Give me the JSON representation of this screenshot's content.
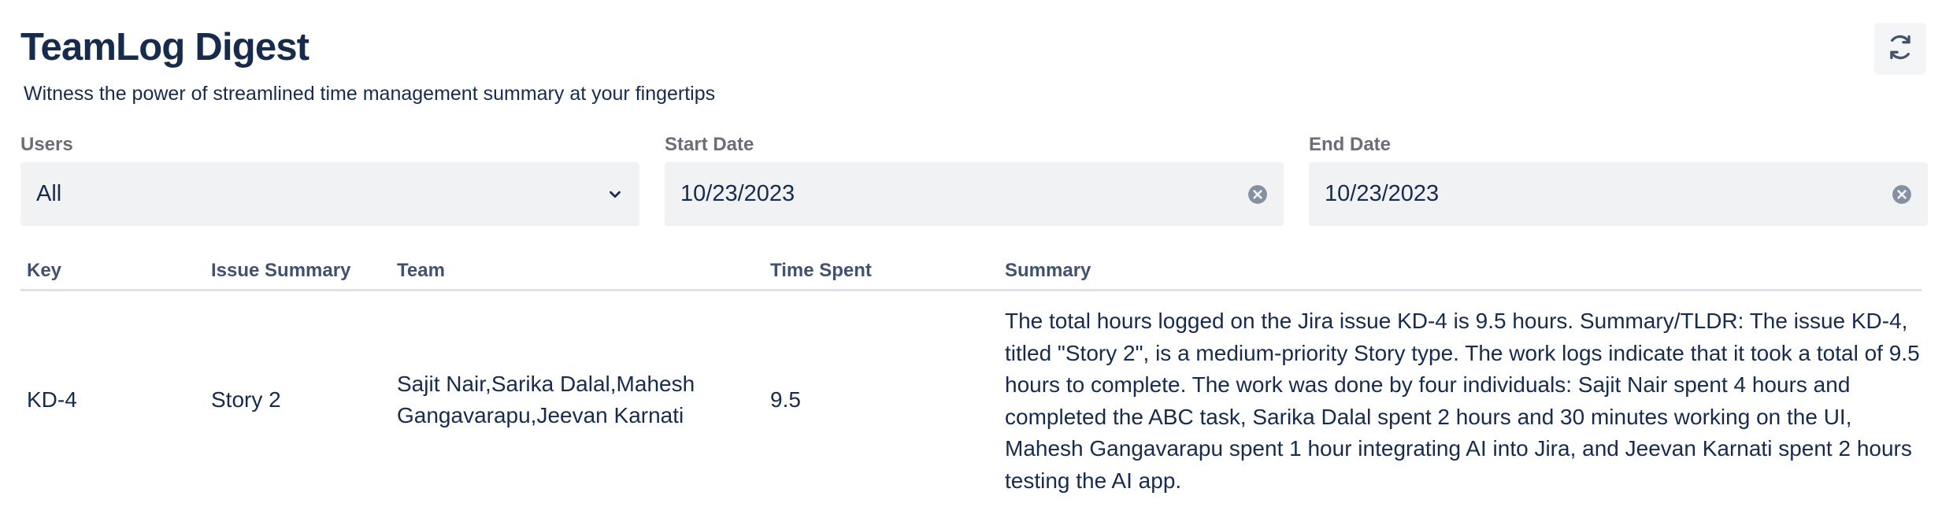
{
  "header": {
    "title": "TeamLog Digest",
    "subtitle": "Witness the power of streamlined time management summary at your fingertips",
    "refresh_icon": "refresh-icon"
  },
  "filters": {
    "users": {
      "label": "Users",
      "value": "All"
    },
    "start_date": {
      "label": "Start Date",
      "value": "10/23/2023"
    },
    "end_date": {
      "label": "End Date",
      "value": "10/23/2023"
    }
  },
  "table": {
    "columns": [
      "Key",
      "Issue Summary",
      "Team",
      "Time Spent",
      "Summary"
    ],
    "rows": [
      {
        "key": "KD-4",
        "issue_summary": "Story 2",
        "team_line1": "Sajit Nair,Sarika Dalal,Mahesh",
        "team_line2": "Gangavarapu,Jeevan Karnati",
        "time_spent": "9.5",
        "summary": "The total hours logged on the Jira issue KD-4 is 9.5 hours. Summary/TLDR: The issue KD-4, titled \"Story 2\", is a medium-priority Story type. The work logs indicate that it took a total of 9.5 hours to complete. The work was done by four individuals: Sajit Nair spent 4 hours and completed the ABC task, Sarika Dalal spent 2 hours and 30 minutes working on the UI, Mahesh Gangavarapu spent 1 hour integrating AI into Jira, and Jeevan Karnati spent 2 hours testing the AI app."
      }
    ]
  },
  "colors": {
    "text": "#172b4d",
    "label": "#6b6e76",
    "field_bg": "#f1f2f4",
    "divider": "#dfe1e6"
  }
}
